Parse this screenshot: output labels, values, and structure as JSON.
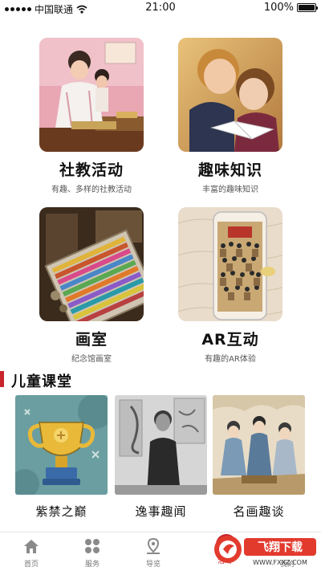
{
  "status_bar": {
    "carrier": "中国联通",
    "time": "21:00",
    "battery_percent": "100%",
    "battery_level": 1.0
  },
  "features": [
    {
      "title": "社教活动",
      "subtitle": "有趣、多样的社教活动",
      "icon": "kids-crafting-photo"
    },
    {
      "title": "趣味知识",
      "subtitle": "丰富的趣味知识",
      "icon": "kids-reading-photo"
    },
    {
      "title": "画室",
      "subtitle": "纪念馆画室",
      "icon": "crayon-box-photo"
    },
    {
      "title": "AR互动",
      "subtitle": "有趣的AR体验",
      "icon": "ar-phone-painting-photo"
    }
  ],
  "section": {
    "title": "儿童课堂"
  },
  "courses": [
    {
      "label": "紫禁之巅",
      "icon": "trophy-illustration"
    },
    {
      "label": "逸事趣闻",
      "icon": "historical-portrait-photo"
    },
    {
      "label": "名画趣谈",
      "icon": "classical-painting"
    }
  ],
  "tabbar": {
    "items": [
      {
        "label": "首页",
        "icon": "home-icon"
      },
      {
        "label": "服务",
        "icon": "grid-icon"
      },
      {
        "label": "导览",
        "icon": "map-pin-icon"
      },
      {
        "label": "活动",
        "icon": "activity-icon"
      },
      {
        "label": "我的",
        "icon": "user-icon"
      }
    ],
    "active_index": 3,
    "active_color": "#c8252c"
  },
  "watermark": {
    "text": "飞翔下载",
    "domain": "WWW.FXXZ.COM"
  },
  "colors": {
    "accent": "#c8252c",
    "text": "#111111",
    "subtext": "#555555"
  }
}
